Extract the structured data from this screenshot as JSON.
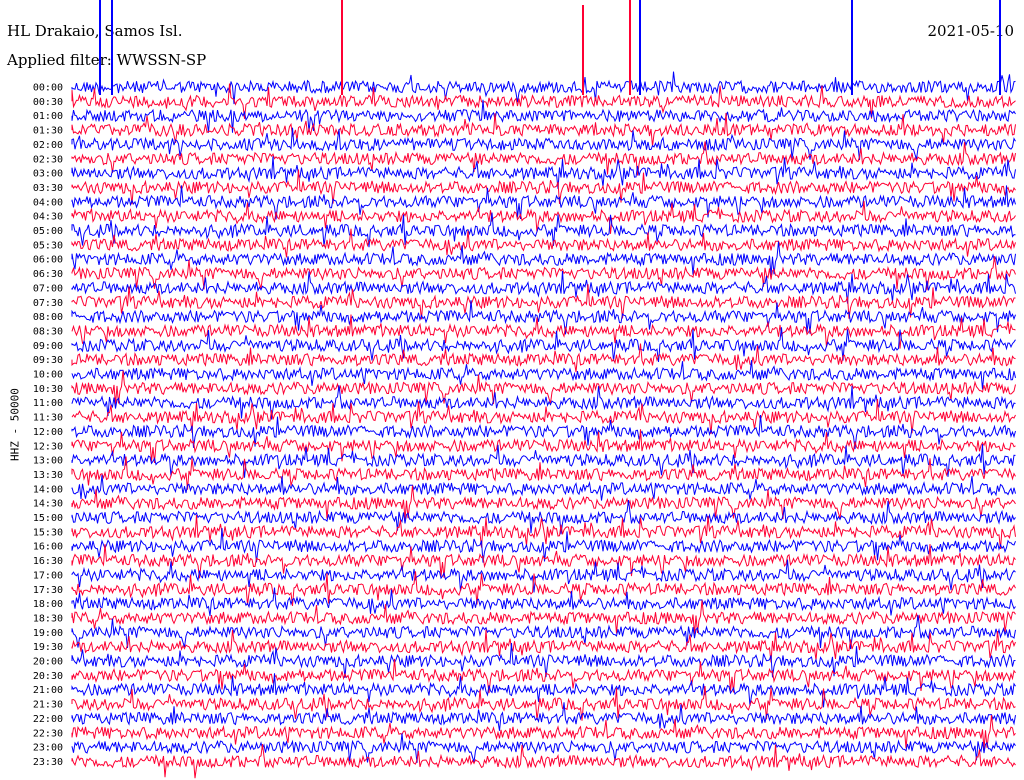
{
  "header": {
    "station": "HL Drakaio, Samos Isl.",
    "filter": "Applied filter: WWSSN-SP",
    "date": "2021-05-10"
  },
  "colors": {
    "trace_a": "#0000ff",
    "trace_b": "#ff0033",
    "background": "#ffffff"
  },
  "chart_data": {
    "type": "line",
    "title": "HL Drakaio, Samos Isl.",
    "ylabel": "HHZ - 50000",
    "xlabel": "",
    "row_labels": [
      "00:00",
      "00:30",
      "01:00",
      "01:30",
      "02:00",
      "02:30",
      "03:00",
      "03:30",
      "04:00",
      "04:30",
      "05:00",
      "05:30",
      "06:00",
      "06:30",
      "07:00",
      "07:30",
      "08:00",
      "08:30",
      "09:00",
      "09:30",
      "10:00",
      "10:30",
      "11:00",
      "11:30",
      "12:00",
      "12:30",
      "13:00",
      "13:30",
      "14:00",
      "14:30",
      "15:00",
      "15:30",
      "16:00",
      "16:30",
      "17:00",
      "17:30",
      "18:00",
      "18:30",
      "19:00",
      "19:30",
      "20:00",
      "20:30",
      "21:00",
      "21:30",
      "22:00",
      "22:30",
      "23:00",
      "23:30"
    ],
    "series_colors": [
      "#0000ff",
      "#ff0033"
    ],
    "grid": false
  }
}
